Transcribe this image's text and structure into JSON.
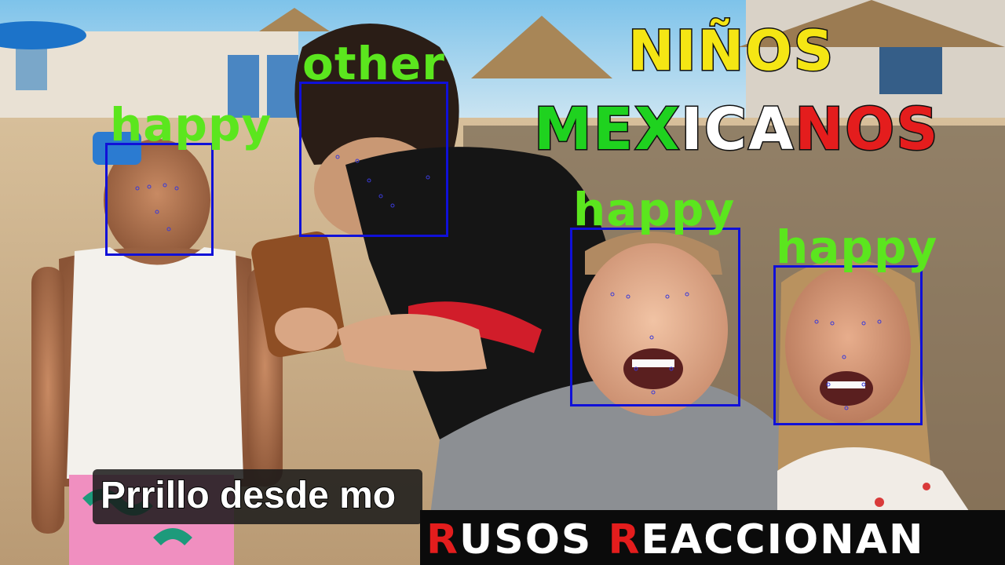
{
  "title": {
    "line1": "NIÑOS",
    "line2_parts": [
      {
        "text": "MEX",
        "color": "#1fd21f"
      },
      {
        "text": "ICA",
        "color": "#ffffff"
      },
      {
        "text": "NOS",
        "color": "#e41d1d"
      }
    ],
    "line1_color": "#f5e614"
  },
  "caption": "Prrillo desde mo",
  "bottom_title": {
    "parts": [
      {
        "text": "R",
        "accent": true
      },
      {
        "text": "USOS ",
        "accent": false
      },
      {
        "text": "R",
        "accent": true
      },
      {
        "text": "EACCIONAN",
        "accent": false
      }
    ],
    "accent_color": "#e41d1d"
  },
  "detections": [
    {
      "label": "happy"
    },
    {
      "label": "other"
    },
    {
      "label": "happy"
    },
    {
      "label": "happy"
    }
  ],
  "colors": {
    "label": "#5be61e",
    "box": "#1010d8"
  }
}
